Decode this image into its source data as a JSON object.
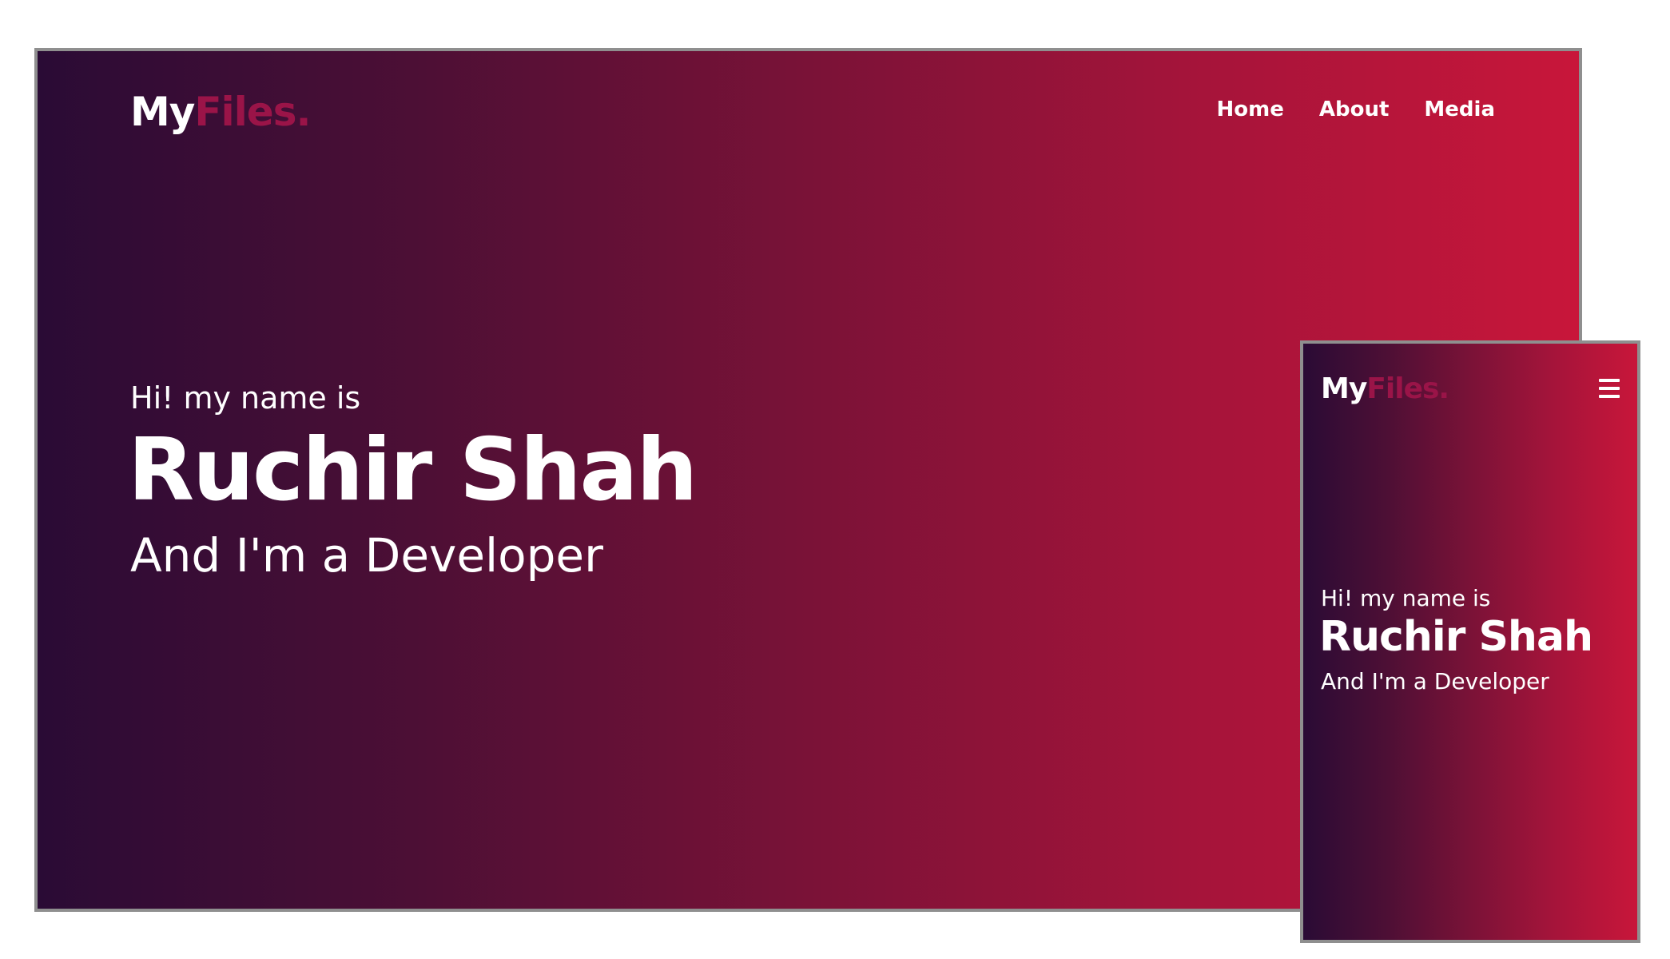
{
  "colors": {
    "gradient_start": "#2a0b35",
    "gradient_end": "#c8163a",
    "logo_accent": "#9a1448",
    "frame_border": "#8f8f8f",
    "text": "#ffffff"
  },
  "desktop": {
    "logo": {
      "primary": "My",
      "accent": "Files."
    },
    "nav": [
      {
        "label": "Home"
      },
      {
        "label": "About"
      },
      {
        "label": "Media"
      }
    ],
    "hero": {
      "greeting": "Hi! my name is",
      "name": "Ruchir Shah",
      "role": "And I'm a Developer"
    }
  },
  "mobile": {
    "logo": {
      "primary": "My",
      "accent": "Files."
    },
    "menu_icon": "hamburger-menu-icon",
    "hero": {
      "greeting": "Hi! my name is",
      "name": "Ruchir Shah",
      "role": "And I'm a Developer"
    }
  }
}
